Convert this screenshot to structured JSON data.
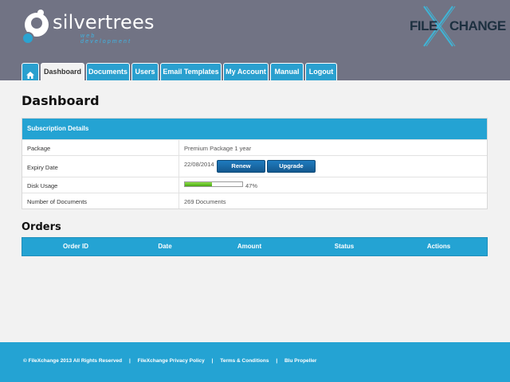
{
  "header": {
    "brand": "silvertrees",
    "brand_sub": "web development",
    "partner_logo_left": "FILE",
    "partner_logo_right": "CHANGE",
    "colors": {
      "header_bg": "#717384",
      "accent": "#24a3d3"
    }
  },
  "nav": {
    "home_icon": "home-icon",
    "tabs": [
      {
        "label": "Dashboard",
        "active": true
      },
      {
        "label": "Documents",
        "active": false
      },
      {
        "label": "Users",
        "active": false
      },
      {
        "label": "Email Templates",
        "active": false
      },
      {
        "label": "My Account",
        "active": false
      },
      {
        "label": "Manual",
        "active": false
      },
      {
        "label": "Logout",
        "active": false
      }
    ]
  },
  "page": {
    "title": "Dashboard"
  },
  "subscription": {
    "heading": "Subscription Details",
    "rows": [
      {
        "label": "Package",
        "value": "Premium Package 1 year"
      },
      {
        "label": "Expiry Date",
        "value": "22/08/2014"
      },
      {
        "label": "Disk Usage",
        "value": "47%"
      },
      {
        "label": "Number of Documents",
        "value": "269 Documents"
      }
    ],
    "renew_label": "Renew",
    "upgrade_label": "Upgrade",
    "disk_usage_fraction": 0.47
  },
  "orders": {
    "title": "Orders",
    "columns": [
      "Order ID",
      "Date",
      "Amount",
      "Status",
      "Actions"
    ]
  },
  "footer": {
    "copyright": "© FileXchange 2013 All Rights Reserved",
    "sep": "|",
    "links": [
      "FileXchange Privacy Policy",
      "Terms & Conditions",
      "Blu Propeller"
    ]
  }
}
